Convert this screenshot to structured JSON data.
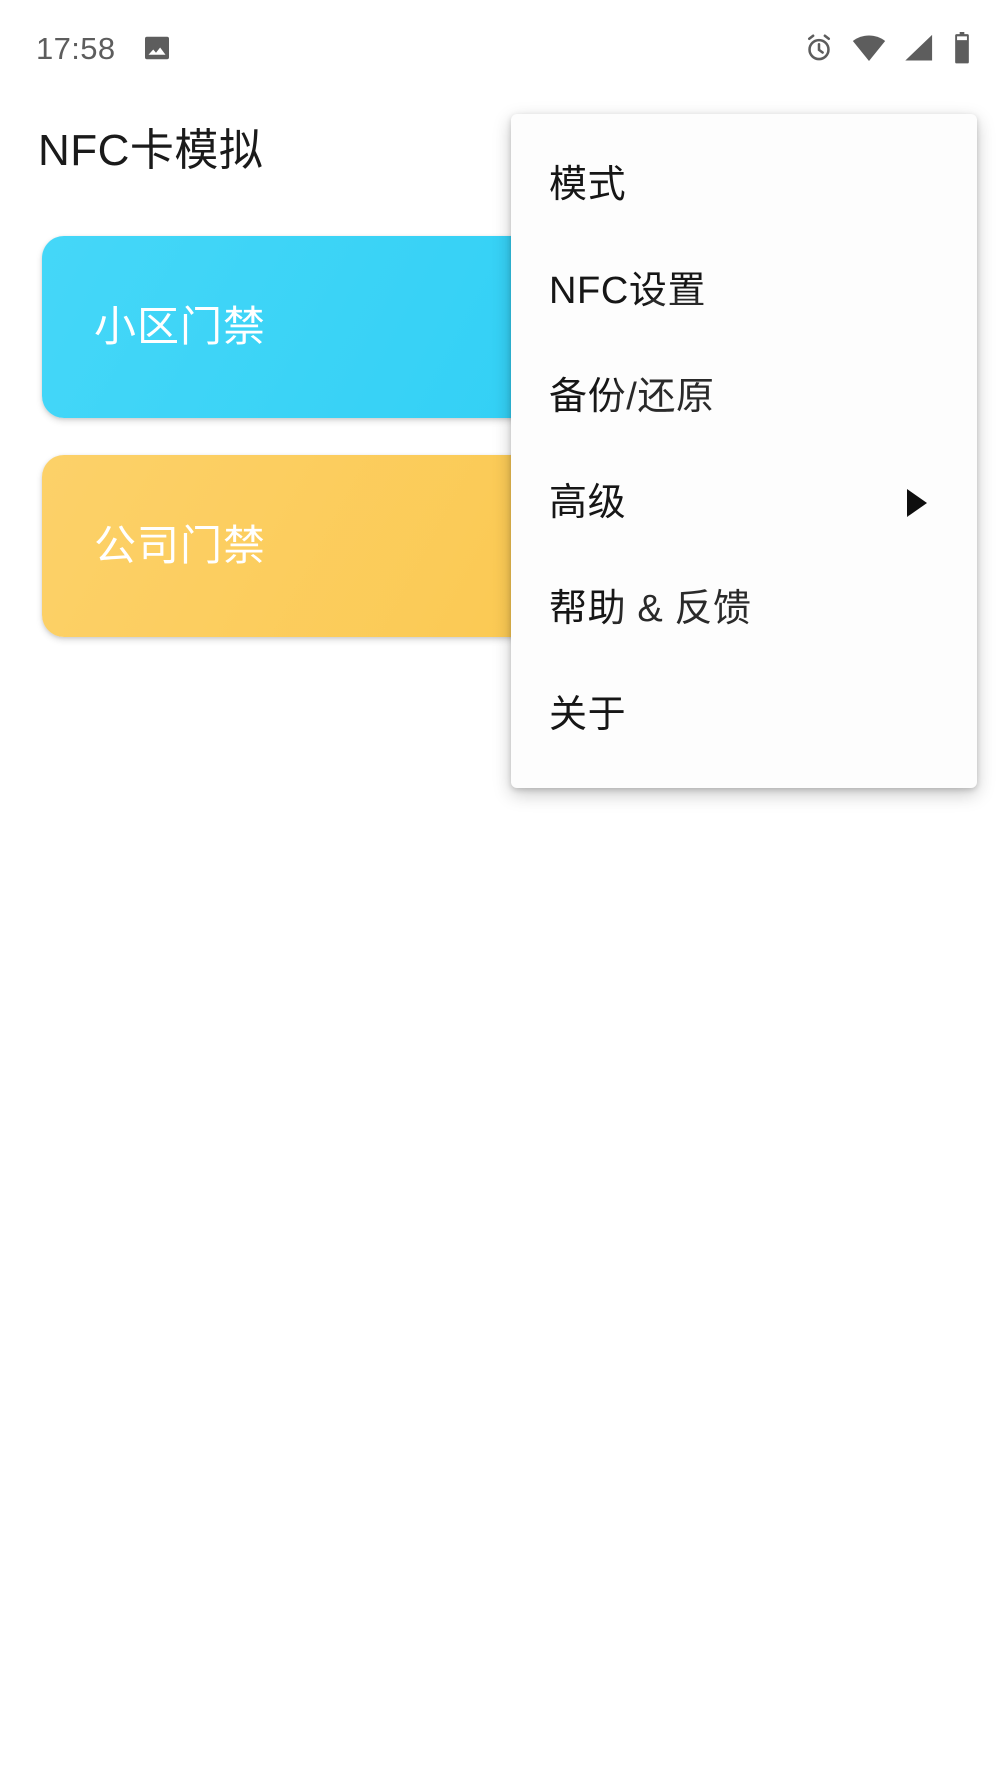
{
  "status_bar": {
    "time": "17:58",
    "left_icons": [
      {
        "name": "image-icon",
        "glyph": "photo"
      }
    ],
    "right_icons": [
      {
        "name": "alarm-clock-icon",
        "glyph": "alarm"
      },
      {
        "name": "wifi-icon",
        "glyph": "wifi"
      },
      {
        "name": "cellular-signal-icon",
        "glyph": "signal"
      },
      {
        "name": "battery-icon",
        "glyph": "battery"
      }
    ],
    "icon_color": "#5d5d5d"
  },
  "header": {
    "title": "NFC卡模拟"
  },
  "cards": [
    {
      "label": "小区门禁",
      "color": "#33d0f5",
      "accent": "blue"
    },
    {
      "label": "公司门禁",
      "color": "#fbc952",
      "accent": "yellow"
    }
  ],
  "popup_menu": {
    "items": [
      {
        "label": "模式",
        "has_submenu": false
      },
      {
        "label": "NFC设置",
        "has_submenu": false
      },
      {
        "label": "备份/还原",
        "has_submenu": false
      },
      {
        "label": "高级",
        "has_submenu": true
      },
      {
        "label": "帮助 & 反馈",
        "has_submenu": false
      },
      {
        "label": "关于",
        "has_submenu": false
      }
    ]
  },
  "theme": {
    "background": "#ffffff",
    "text_primary": "#161616",
    "menu_background": "#fdfdfd"
  }
}
